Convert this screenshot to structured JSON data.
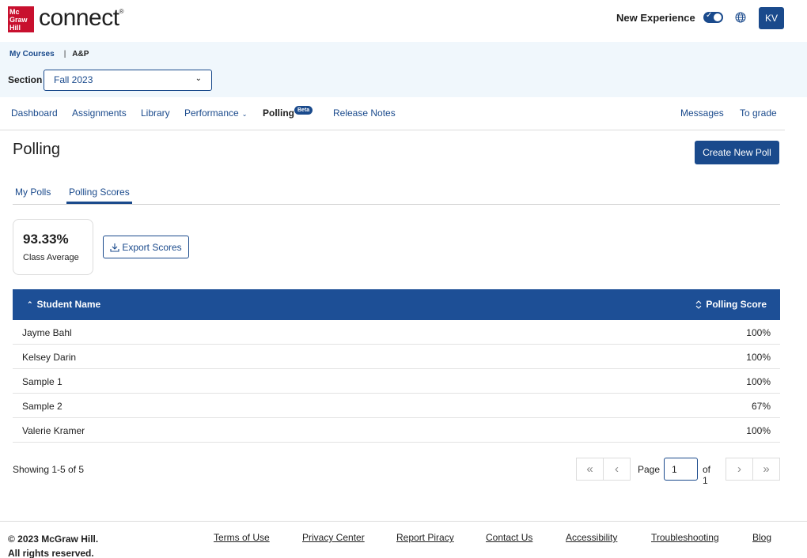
{
  "header": {
    "logo_lines": [
      "Mc",
      "Graw",
      "Hill"
    ],
    "product_name": "connect",
    "new_experience_label": "New Experience",
    "avatar_initials": "KV"
  },
  "breadcrumb": {
    "my_courses": "My Courses",
    "separator": "|",
    "current": "A&P"
  },
  "section": {
    "label": "Section",
    "selected": "Fall 2023"
  },
  "nav": {
    "dashboard": "Dashboard",
    "assignments": "Assignments",
    "library": "Library",
    "performance": "Performance",
    "polling": "Polling",
    "beta": "Beta",
    "release_notes": "Release Notes",
    "messages": "Messages",
    "to_grade": "To grade"
  },
  "page": {
    "title": "Polling",
    "create_button": "Create New Poll"
  },
  "tabs": {
    "my_polls": "My Polls",
    "polling_scores": "Polling Scores"
  },
  "summary": {
    "class_average_value": "93.33%",
    "class_average_label": "Class Average",
    "export_label": "Export Scores"
  },
  "table": {
    "col_name": "Student Name",
    "col_score": "Polling Score",
    "rows": [
      {
        "name": "Jayme Bahl",
        "score": "100%"
      },
      {
        "name": "Kelsey Darin",
        "score": "100%"
      },
      {
        "name": "Sample 1",
        "score": "100%"
      },
      {
        "name": "Sample 2",
        "score": "67%"
      },
      {
        "name": "Valerie Kramer",
        "score": "100%"
      }
    ]
  },
  "pagination": {
    "showing": "Showing 1-5 of 5",
    "page_label": "Page",
    "current_page": "1",
    "of_label": "of 1"
  },
  "footer": {
    "copyright_line1": "© 2023 McGraw Hill.",
    "copyright_line2": "All rights reserved.",
    "links": [
      "Terms of Use",
      "Privacy Center",
      "Report Piracy",
      "Contact Us",
      "Accessibility",
      "Troubleshooting",
      "Blog"
    ]
  },
  "colors": {
    "brand_navy": "#1a4a8c",
    "table_header": "#1d4f96",
    "logo_red": "#c8102e",
    "context_band": "#f0f7fc"
  }
}
